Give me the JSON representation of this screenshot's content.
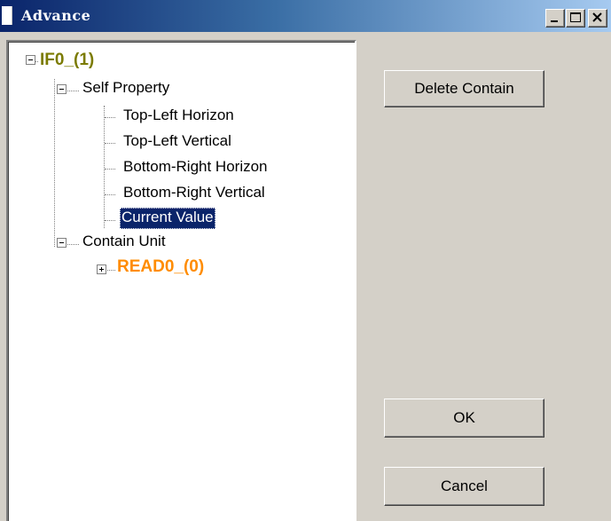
{
  "window": {
    "title": "Advance",
    "caption_buttons": {
      "minimize": "minimize-icon",
      "maximize": "maximize-icon",
      "close": "close-icon"
    }
  },
  "tree": {
    "root": {
      "label": "IF0_(1)",
      "color": "#7b7b00",
      "expanded": true
    },
    "self_property": {
      "label": "Self Property",
      "expanded": true,
      "children": [
        "Top-Left Horizon",
        "Top-Left Vertical",
        "Bottom-Right Horizon",
        "Bottom-Right Vertical",
        "Current Value"
      ],
      "selected": "Current Value"
    },
    "contain_unit": {
      "label": "Contain Unit",
      "expanded": true,
      "children": [
        {
          "label": "READ0_(0)",
          "color": "#ff8c00",
          "expanded": false
        }
      ]
    }
  },
  "buttons": {
    "delete_contain": "Delete Contain",
    "ok": "OK",
    "cancel": "Cancel"
  }
}
